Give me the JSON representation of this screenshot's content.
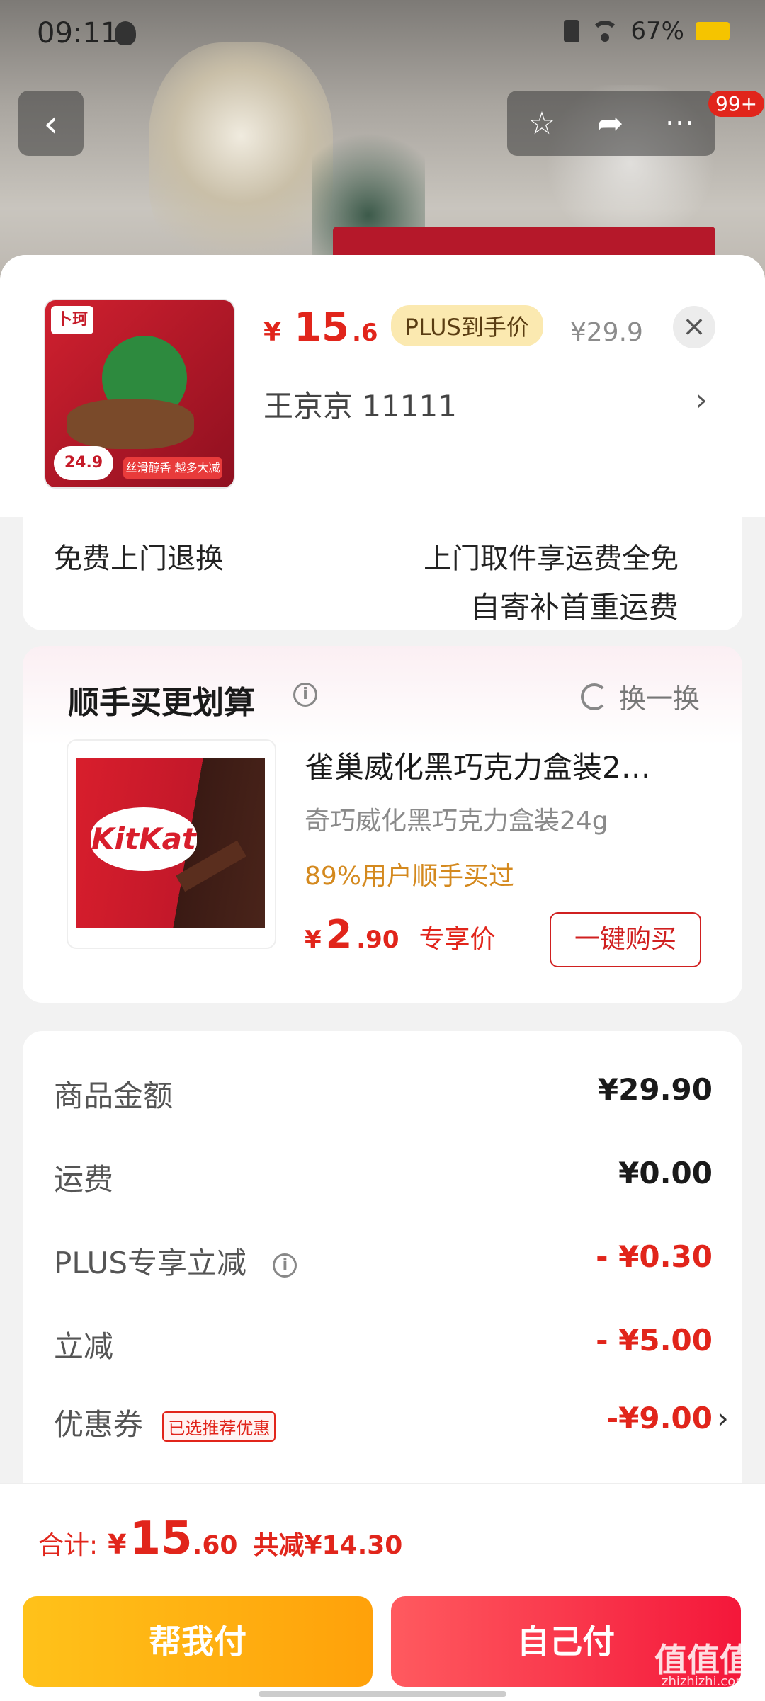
{
  "status_bar": {
    "time": "09:11",
    "battery": "67%"
  },
  "nav": {
    "back_icon": "‹",
    "star_icon": "☆",
    "share_icon": "➦",
    "more_icon": "···",
    "badge": "99+"
  },
  "product": {
    "price_currency": "¥",
    "price_int": "15",
    "price_dec": ".6",
    "plus_tag": "PLUS到手价",
    "original_price": "¥29.9",
    "close_icon": "×",
    "address": "王京京  11111",
    "address_chevron": "›",
    "thumb_brand": "卜珂",
    "thumb_price": "24.9",
    "thumb_strip": "丝滑醇香 越多大减"
  },
  "partial_card": {
    "left_text": "免费上门退换",
    "right_text": "上门取件享运费全免",
    "right_text2": "自寄补首重运费"
  },
  "addon": {
    "title": "顺手买更划算",
    "info_icon": "i",
    "refresh_label": "换一换",
    "name": "雀巢威化黑巧克力盒装2…",
    "subtitle": "奇巧威化黑巧克力盒装24g",
    "percent_text": "89%用户顺手买过",
    "price_currency": "¥",
    "price_int": "2",
    "price_dec": ".90",
    "price_label": "专享价",
    "buy_label": "一键购买",
    "logo_text": "KitKat"
  },
  "details": {
    "rows": [
      {
        "label": "商品金额",
        "value": "¥29.90"
      },
      {
        "label": "运费",
        "value": "¥0.00"
      },
      {
        "label": "PLUS专享立减",
        "value": "- ¥0.30"
      },
      {
        "label": "立减",
        "value": "- ¥5.00"
      },
      {
        "label": "优惠券",
        "tag": "已选推荐优惠",
        "value": "-¥9.00"
      }
    ],
    "chevron": "›"
  },
  "footer": {
    "total_label": "合计:",
    "total_currency": "¥",
    "total_int": "15",
    "total_dec": ".60",
    "total_saved": "共减¥14.30",
    "pay_friend_label": "帮我付",
    "pay_self_label": "自己付",
    "watermark": "值值值",
    "watermark_sub": "zhizhizhi.com"
  },
  "colors": {
    "accent_red": "#e1251b",
    "pay_friend": "#ffb010",
    "pay_self": "#f4173a"
  }
}
